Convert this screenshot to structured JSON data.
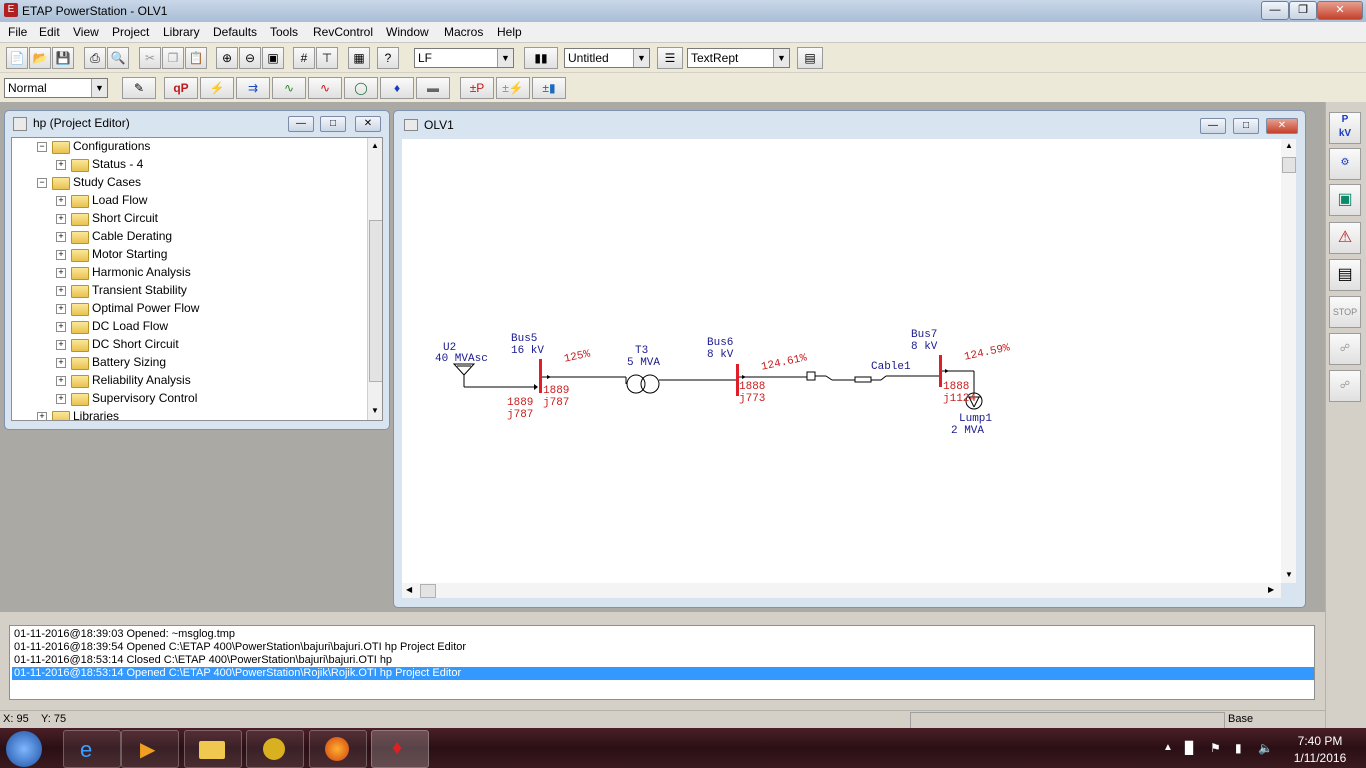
{
  "window": {
    "title": "ETAP PowerStation - OLV1",
    "app_icon": "etap-app-icon"
  },
  "menu": [
    "File",
    "Edit",
    "View",
    "Project",
    "Library",
    "Defaults",
    "Tools",
    "RevControl",
    "Window",
    "Macros",
    "Help"
  ],
  "toolbar": {
    "study_mode": "LF",
    "config": "Untitled",
    "report": "TextRept",
    "normal": "Normal"
  },
  "project_editor": {
    "title": "hp (Project Editor)",
    "items": [
      {
        "label": "Configurations",
        "level": 1,
        "sign": "−"
      },
      {
        "label": "Status - 4",
        "level": 2,
        "sign": "+"
      },
      {
        "label": "Study Cases",
        "level": 1,
        "sign": "−"
      },
      {
        "label": "Load Flow",
        "level": 2,
        "sign": "+"
      },
      {
        "label": "Short Circuit",
        "level": 2,
        "sign": "+"
      },
      {
        "label": "Cable Derating",
        "level": 2,
        "sign": "+"
      },
      {
        "label": "Motor Starting",
        "level": 2,
        "sign": "+"
      },
      {
        "label": "Harmonic Analysis",
        "level": 2,
        "sign": "+"
      },
      {
        "label": "Transient Stability",
        "level": 2,
        "sign": "+"
      },
      {
        "label": "Optimal Power Flow",
        "level": 2,
        "sign": "+"
      },
      {
        "label": "DC Load Flow",
        "level": 2,
        "sign": "+"
      },
      {
        "label": "DC Short Circuit",
        "level": 2,
        "sign": "+"
      },
      {
        "label": "Battery Sizing",
        "level": 2,
        "sign": "+"
      },
      {
        "label": "Reliability Analysis",
        "level": 2,
        "sign": "+"
      },
      {
        "label": "Supervisory Control",
        "level": 2,
        "sign": "+"
      },
      {
        "label": "Libraries",
        "level": 0,
        "sign": "+"
      }
    ]
  },
  "olv": {
    "title": "OLV1",
    "u2": {
      "name": "U2",
      "rating": "40 MVAsc",
      "p": "1889",
      "q": "j787"
    },
    "bus5": {
      "name": "Bus5",
      "kv": "16 kV",
      "pct": "125%",
      "p": "1889",
      "q": "j787"
    },
    "t3": {
      "name": "T3",
      "rating": "5 MVA"
    },
    "bus6": {
      "name": "Bus6",
      "kv": "8 kV",
      "pct": "124.61%",
      "p": "1888",
      "q": "j773"
    },
    "cable1": {
      "name": "Cable1"
    },
    "bus7": {
      "name": "Bus7",
      "kv": "8 kV",
      "pct": "124.59%",
      "p": "1888",
      "q": "j1124"
    },
    "lump1": {
      "name": "Lump1",
      "rating": "2 MVA"
    }
  },
  "log": [
    {
      "text": "01-11-2016@18:39:03 Opened: ~msglog.tmp",
      "selected": false
    },
    {
      "text": "01-11-2016@18:39:54 Opened C:\\ETAP 400\\PowerStation\\bajuri\\bajuri.OTI hp Project Editor",
      "selected": false
    },
    {
      "text": "01-11-2016@18:53:14 Closed C:\\ETAP 400\\PowerStation\\bajuri\\bajuri.OTI hp",
      "selected": false
    },
    {
      "text": "01-11-2016@18:53:14 Opened C:\\ETAP 400\\PowerStation\\Rojik\\Rojik.OTI hp Project Editor",
      "selected": true
    }
  ],
  "status": {
    "x": "X: 95",
    "y": "Y: 75",
    "mode": "Base"
  },
  "taskbar": {
    "time": "7:40 PM",
    "date": "1/11/2016"
  },
  "colors": {
    "accent_select": "#3399ff",
    "bus_red": "#e01e2a",
    "label_blue": "#1a1a8c",
    "value_red": "#c81e1e"
  }
}
